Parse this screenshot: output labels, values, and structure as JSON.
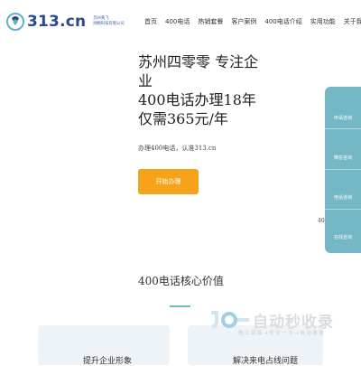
{
  "brand": {
    "logo_text": "313.cn",
    "sub_line1": "苏州黄飞",
    "sub_line2": "网络科技有限公司"
  },
  "nav": {
    "items": [
      {
        "label": "首页"
      },
      {
        "label": "400电话"
      },
      {
        "label": "热销套餐"
      },
      {
        "label": "客户案例"
      },
      {
        "label": "400电话介绍"
      },
      {
        "label": "实用功能"
      },
      {
        "label": "关于我们"
      }
    ]
  },
  "hero": {
    "title_line1": "苏州四零零 专注企",
    "title_line2": "业",
    "title_line3": "400电话办理18年",
    "title_line4": "仅需365元/年",
    "desc": "办理400电话，认准313.cn",
    "cta_label": "开始办理"
  },
  "side_panel": {
    "items": [
      {
        "label": "申请咨询"
      },
      {
        "label": "微信咨询"
      },
      {
        "label": "电话咨询"
      },
      {
        "label": "在线咨询"
      }
    ],
    "peek_text": "40",
    "color": "#74b8c5"
  },
  "section": {
    "title": "400电话核心价值",
    "cards": [
      {
        "title": "提升企业形象"
      },
      {
        "title": "解决来电占线问题"
      }
    ]
  },
  "watermark": {
    "text": "自动秒收录",
    "slogan": "做上链接→来访一次→自动收录"
  },
  "colors": {
    "accent": "#f7a21b",
    "teal": "#74b8c5",
    "brand_blue": "#2a4a8a"
  }
}
